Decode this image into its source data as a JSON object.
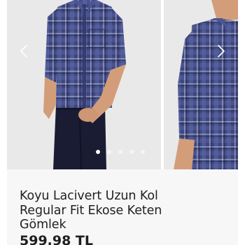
{
  "product": {
    "title_line1": "Koyu Lacivert Uzun Kol",
    "title_line2": "Regular Fit Ekose Keten",
    "title_line3": "Gömlek",
    "price": "599,98 TL"
  },
  "gallery": {
    "current_slide": 1,
    "total_slides": 5,
    "prev_icon": "chevron-left-icon",
    "next_icon": "chevron-right-icon"
  },
  "colors": {
    "shirt": "#3e467c",
    "pants": "#1a1c33",
    "skin": "#d39d7a",
    "background": "#e9e9ea",
    "info_panel": "#f7f7f7"
  }
}
